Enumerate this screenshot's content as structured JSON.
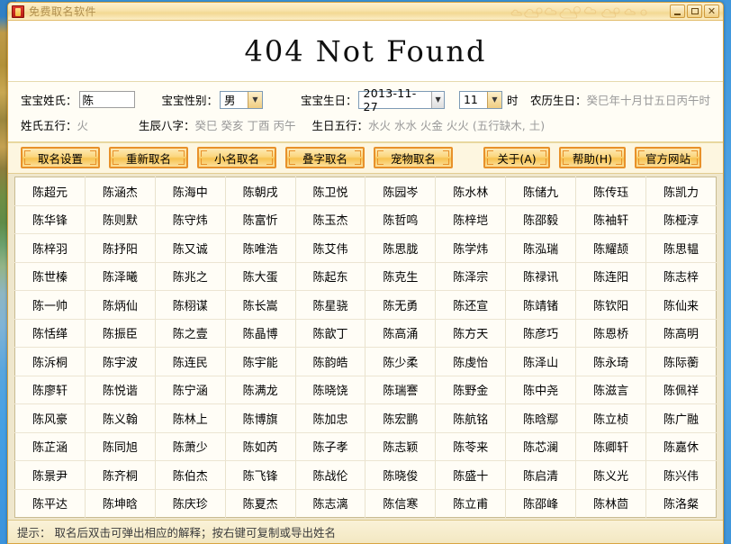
{
  "window": {
    "title": "免费取名软件",
    "icon": "app-icon",
    "minimize_label": "−",
    "maximize_label": "□",
    "close_label": "✕"
  },
  "header": {
    "title": "404 Not Found"
  },
  "form": {
    "surname_label": "宝宝姓氏：",
    "surname_value": "陈",
    "gender_label": "宝宝性别：",
    "gender_value": "男",
    "birthday_label": "宝宝生日：",
    "birthday_value": "2013-11-27",
    "hour_value": "11",
    "hour_unit": "时",
    "lunar_label": "农历生日：",
    "lunar_value": "癸巳年十月廿五日丙午时",
    "surname_wuxing_label": "姓氏五行：",
    "surname_wuxing_value": "火",
    "bazi_label": "生辰八字：",
    "bazi_value": "癸巳 癸亥 丁酉 丙午",
    "birth_wuxing_label": "生日五行：",
    "birth_wuxing_value": "水火 水水 火金 火火 (五行缺木, 土)"
  },
  "toolbar": {
    "buttons": [
      {
        "label": "取名设置",
        "name": "naming-settings-button"
      },
      {
        "label": "重新取名",
        "name": "regenerate-names-button"
      },
      {
        "label": "小名取名",
        "name": "nickname-button"
      },
      {
        "label": "叠字取名",
        "name": "reduplicated-name-button"
      },
      {
        "label": "宠物取名",
        "name": "pet-name-button"
      }
    ],
    "right_buttons": [
      {
        "label": "关于(A)",
        "name": "about-button"
      },
      {
        "label": "帮助(H)",
        "name": "help-button"
      },
      {
        "label": "官方网站",
        "name": "official-site-button"
      }
    ]
  },
  "grid": {
    "rows": [
      [
        "陈超元",
        "陈涵杰",
        "陈海中",
        "陈朝戌",
        "陈卫悦",
        "陈园岑",
        "陈水林",
        "陈储九",
        "陈传珏",
        "陈凯力"
      ],
      [
        "陈华锋",
        "陈则默",
        "陈守炜",
        "陈富忻",
        "陈玉杰",
        "陈哲鸣",
        "陈梓垲",
        "陈邵毅",
        "陈袖轩",
        "陈桠淳"
      ],
      [
        "陈梓羽",
        "陈抒阳",
        "陈又诚",
        "陈唯浩",
        "陈艾伟",
        "陈思胧",
        "陈学炜",
        "陈泓瑞",
        "陈耀颉",
        "陈思韫"
      ],
      [
        "陈世榛",
        "陈泽曦",
        "陈兆之",
        "陈大蛋",
        "陈起东",
        "陈克生",
        "陈泽宗",
        "陈禄讯",
        "陈连阳",
        "陈志梓"
      ],
      [
        "陈一帅",
        "陈炳仙",
        "陈栩谋",
        "陈长嵩",
        "陈星骁",
        "陈无勇",
        "陈还宣",
        "陈靖锗",
        "陈钦阳",
        "陈仙来"
      ],
      [
        "陈恬缂",
        "陈振臣",
        "陈之壹",
        "陈晶博",
        "陈歆丁",
        "陈高涌",
        "陈方天",
        "陈彦巧",
        "陈恩桥",
        "陈高明"
      ],
      [
        "陈泝桐",
        "陈宇波",
        "陈连民",
        "陈宇能",
        "陈韵皓",
        "陈少柔",
        "陈虔怡",
        "陈泽山",
        "陈永琦",
        "陈际蘅"
      ],
      [
        "陈廖轩",
        "陈悦谐",
        "陈宁涵",
        "陈满龙",
        "陈晓饶",
        "陈瑞謇",
        "陈野金",
        "陈中尧",
        "陈滋言",
        "陈佩祥"
      ],
      [
        "陈风豪",
        "陈义翰",
        "陈林上",
        "陈博旗",
        "陈加忠",
        "陈宏鹏",
        "陈航铭",
        "陈晗鄢",
        "陈立桢",
        "陈广融"
      ],
      [
        "陈芷涵",
        "陈同旭",
        "陈萧少",
        "陈如芮",
        "陈子孝",
        "陈志颖",
        "陈苓来",
        "陈芯澜",
        "陈卿轩",
        "陈嘉休"
      ],
      [
        "陈景尹",
        "陈齐桐",
        "陈伯杰",
        "陈飞锋",
        "陈战伦",
        "陈晓俊",
        "陈盛十",
        "陈启清",
        "陈义光",
        "陈兴伟"
      ],
      [
        "陈平达",
        "陈坤晗",
        "陈庆珍",
        "陈夏杰",
        "陈志漓",
        "陈信寒",
        "陈立甫",
        "陈邵峰",
        "陈林茴",
        "陈洛粲"
      ]
    ]
  },
  "status": {
    "text": "提示： 取名后双击可弹出相应的解释；按右键可复制或导出姓名"
  },
  "colors": {
    "window_border": "#d9a441",
    "button_border": "#e8912a",
    "title_text": "#b09050",
    "panel_bg": "#fffdf5",
    "grid_bg": "#fffdf6",
    "muted_text": "#999999"
  }
}
